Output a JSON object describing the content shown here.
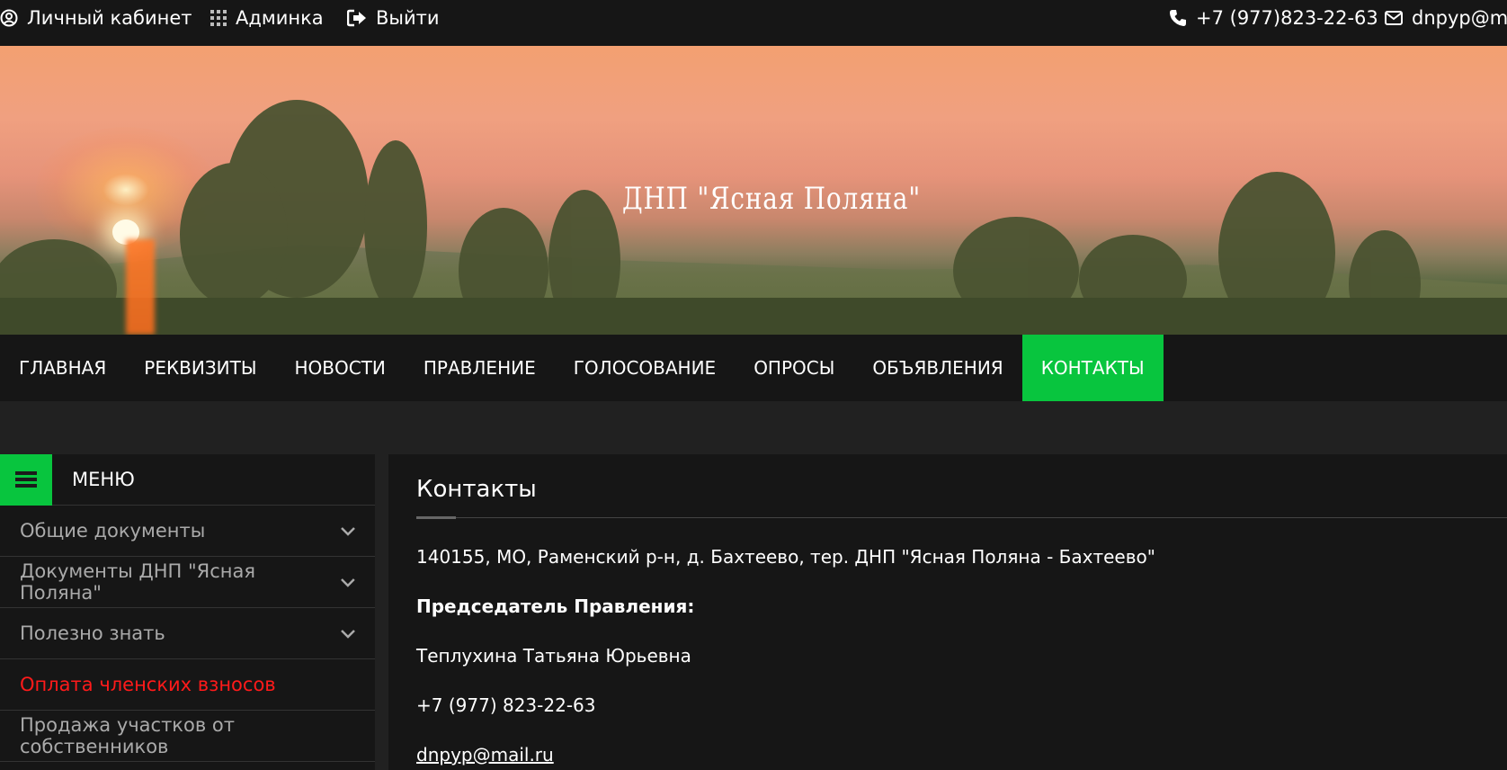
{
  "topbar": {
    "cabinet": "Личный кабинет",
    "admin": "Админка",
    "logout": "Выйти",
    "phone": "+7 (977)823-22-63",
    "email": "dnpyp@ma"
  },
  "banner": {
    "title": "ДНП \"Ясная Поляна\""
  },
  "nav": {
    "items": [
      "ГЛАВНАЯ",
      "РЕКВИЗИТЫ",
      "НОВОСТИ",
      "ПРАВЛЕНИЕ",
      "ГОЛОСОВАНИЕ",
      "ОПРОСЫ",
      "ОБЪЯВЛЕНИЯ",
      "КОНТАКТЫ"
    ],
    "active": "КОНТАКТЫ"
  },
  "sidebar": {
    "title": "МЕНЮ",
    "items": [
      {
        "label": "Общие документы"
      },
      {
        "label": "Документы ДНП \"Ясная Поляна\""
      },
      {
        "label": "Полезно знать"
      },
      {
        "label": "Оплата членских взносов"
      },
      {
        "label": "Продажа участков от собственников"
      }
    ]
  },
  "content": {
    "title": "Контакты",
    "address": "140155, МО, Раменский р-н, д. Бахтеево, тер. ДНП \"Ясная Поляна - Бахтеево\"",
    "chair_heading": "Председатель Правления:",
    "chair_name": "Теплухина Татьяна Юрьевна",
    "phone": "+7 (977) 823-22-63",
    "email": "dnpyp@mail.ru"
  },
  "colors": {
    "accent": "#08c53e",
    "highlight_red": "#ff1a1a",
    "bar_bg": "#161616",
    "page_bg": "#212121"
  },
  "icons": [
    "user-circle-icon",
    "grid-icon",
    "logout-icon",
    "phone-icon",
    "envelope-icon",
    "hamburger-icon",
    "chevron-down-icon"
  ]
}
